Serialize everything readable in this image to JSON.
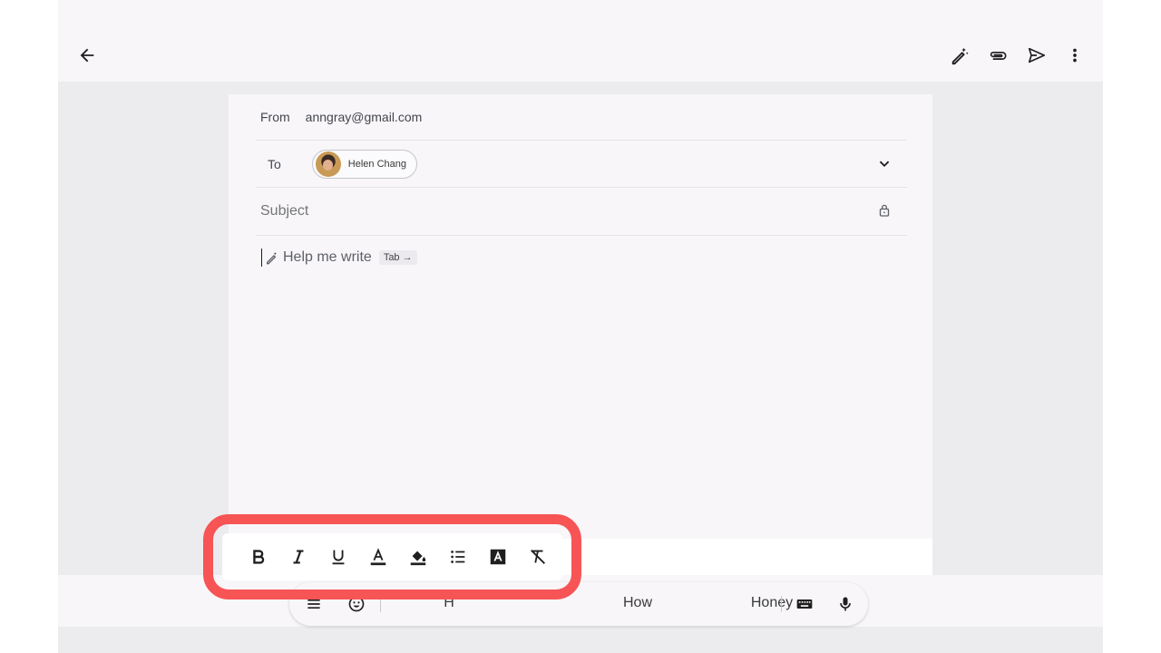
{
  "compose": {
    "from_label": "From",
    "from_value": "anngray@gmail.com",
    "to_label": "To",
    "recipient_name": "Helen Chang",
    "subject_placeholder": "Subject",
    "help_me_write": "Help me write",
    "tab_hint": "Tab →"
  },
  "toolbar_icons": [
    "back-arrow-icon",
    "magic-pen-icon",
    "paperclip-icon",
    "send-icon",
    "more-vert-icon"
  ],
  "format_bar": [
    "bold",
    "italic",
    "underline",
    "text-color",
    "fill-color",
    "bulleted-list",
    "text-style",
    "clear-formatting"
  ],
  "keyboard": {
    "suggestions": [
      "H",
      "How",
      "Honey"
    ]
  },
  "colors": {
    "highlight": "#f75456",
    "surface": "#f8f6f9",
    "background": "#ececee"
  }
}
